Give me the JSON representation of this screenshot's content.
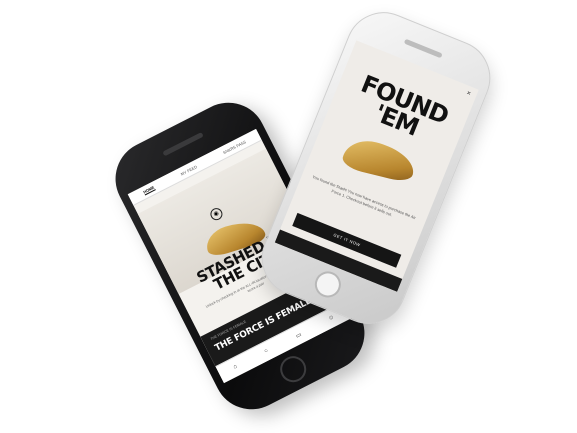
{
  "black_phone": {
    "tabs": [
      "HOME",
      "MY FEED",
      "SNKRS PASS"
    ],
    "headline": "STASHED IN THE CITY",
    "copy": "Unlock by checking in at the ALL-IN location of your SNKRS Stash to score a pair",
    "banner_kicker": "THE FORCE IS FEMALE",
    "banner_title": "THE FORCE IS FEMALE",
    "nav_icons": [
      "home-icon",
      "search-icon",
      "inbox-icon",
      "profile-icon"
    ]
  },
  "silver_phone": {
    "headline": "FOUND 'EM",
    "copy": "You found the Stash! You now have access to purchase the Air Force 1. Checkout before it sells out.",
    "cta": "GET IT NOW",
    "close_label": "×"
  },
  "colors": {
    "shoe_gold": "#c99a3e",
    "black_body": "#0b0b0c",
    "silver_body": "#dcdcdc"
  }
}
